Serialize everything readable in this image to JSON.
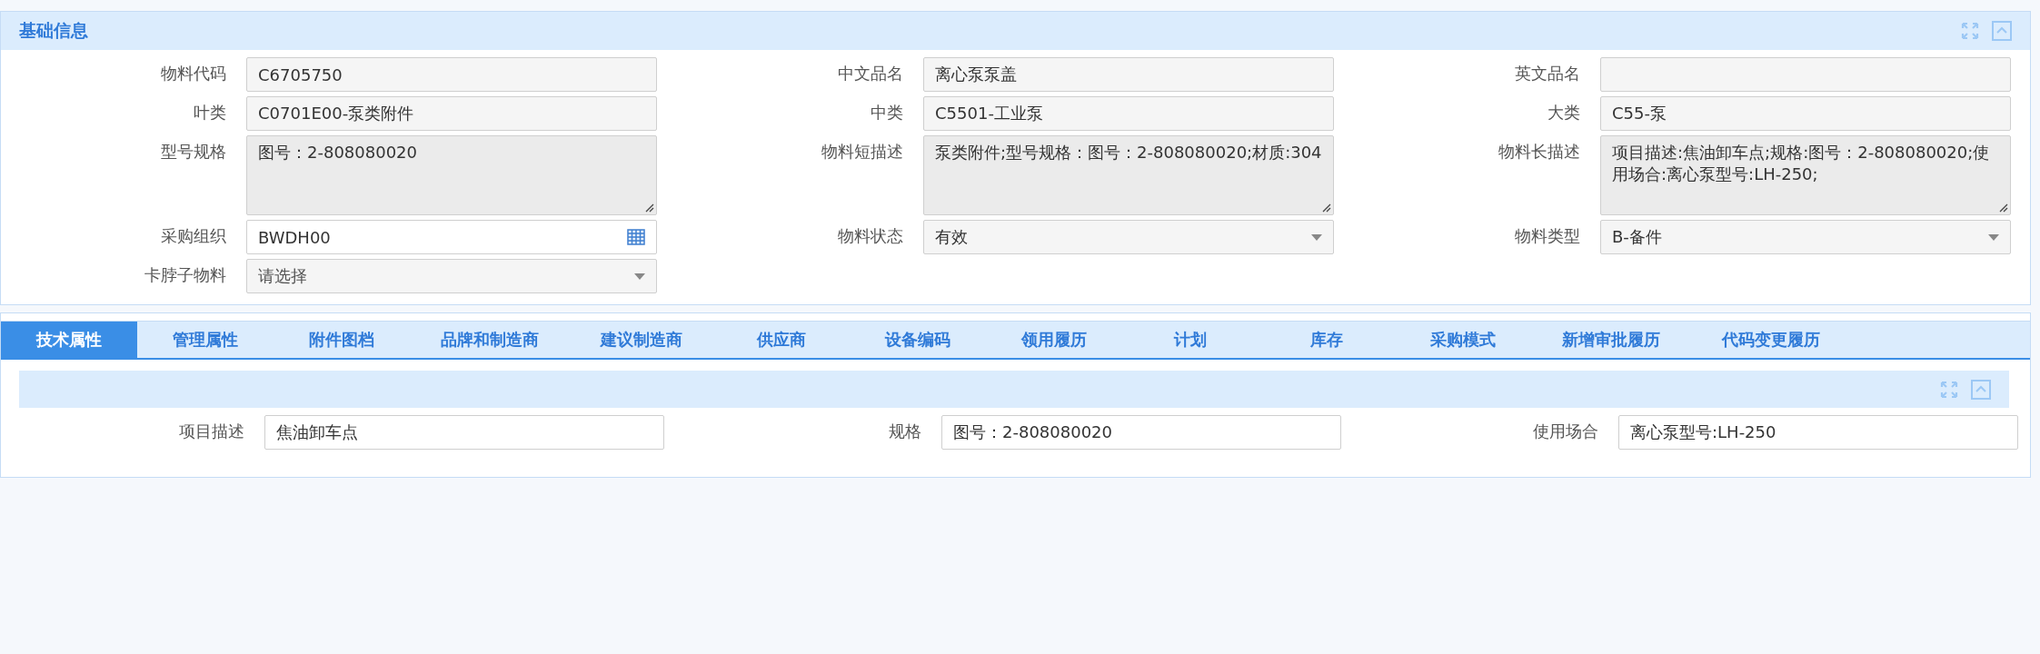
{
  "basic_info": {
    "title": "基础信息",
    "fields": [
      {
        "label": "物料代码",
        "kind": "text",
        "value": "C6705750"
      },
      {
        "label": "中文品名",
        "kind": "text",
        "value": "离心泵泵盖"
      },
      {
        "label": "英文品名",
        "kind": "text"
      },
      {
        "label": "叶类",
        "kind": "text",
        "value": "C0701E00-泵类附件"
      },
      {
        "label": "中类",
        "kind": "text",
        "value": "C5501-工业泵"
      },
      {
        "label": "大类",
        "kind": "text",
        "value": "C55-泵"
      },
      {
        "label": "型号规格",
        "kind": "textarea",
        "value": "图号：2-808080020"
      },
      {
        "label": "物料短描述",
        "kind": "textarea",
        "value": "泵类附件;型号规格：图号：2-808080020;材质:304"
      },
      {
        "label": "物料长描述",
        "kind": "textarea",
        "value": "项目描述:焦油卸车点;规格:图号：2-808080020;使用场合:离心泵型号:LH-250;"
      },
      {
        "label": "采购组织",
        "kind": "picker",
        "value": "BWDH00"
      },
      {
        "label": "物料状态",
        "kind": "select",
        "value": "有效"
      },
      {
        "label": "物料类型",
        "kind": "select",
        "value": "B-备件"
      },
      {
        "label": "卡脖子物料",
        "kind": "select",
        "placeholder": "请选择"
      }
    ]
  },
  "tabs": [
    {
      "label": "技术属性",
      "selected": true
    },
    {
      "label": "管理属性",
      "selected": false
    },
    {
      "label": "附件图档",
      "selected": false
    },
    {
      "label": "品牌和制造商",
      "selected": false
    },
    {
      "label": "建议制造商",
      "selected": false
    },
    {
      "label": "供应商",
      "selected": false
    },
    {
      "label": "设备编码",
      "selected": false
    },
    {
      "label": "领用履历",
      "selected": false
    },
    {
      "label": "计划",
      "selected": false
    },
    {
      "label": "库存",
      "selected": false
    },
    {
      "label": "采购模式",
      "selected": false
    },
    {
      "label": "新增审批履历",
      "selected": false
    },
    {
      "label": "代码变更履历",
      "selected": false
    }
  ],
  "tech_attributes": {
    "fields": [
      {
        "label": "项目描述",
        "kind": "input",
        "value": "焦油卸车点"
      },
      {
        "label": "规格",
        "kind": "input",
        "value": "图号：2-808080020"
      },
      {
        "label": "使用场合",
        "kind": "input",
        "value": "离心泵型号:LH-250"
      }
    ]
  }
}
